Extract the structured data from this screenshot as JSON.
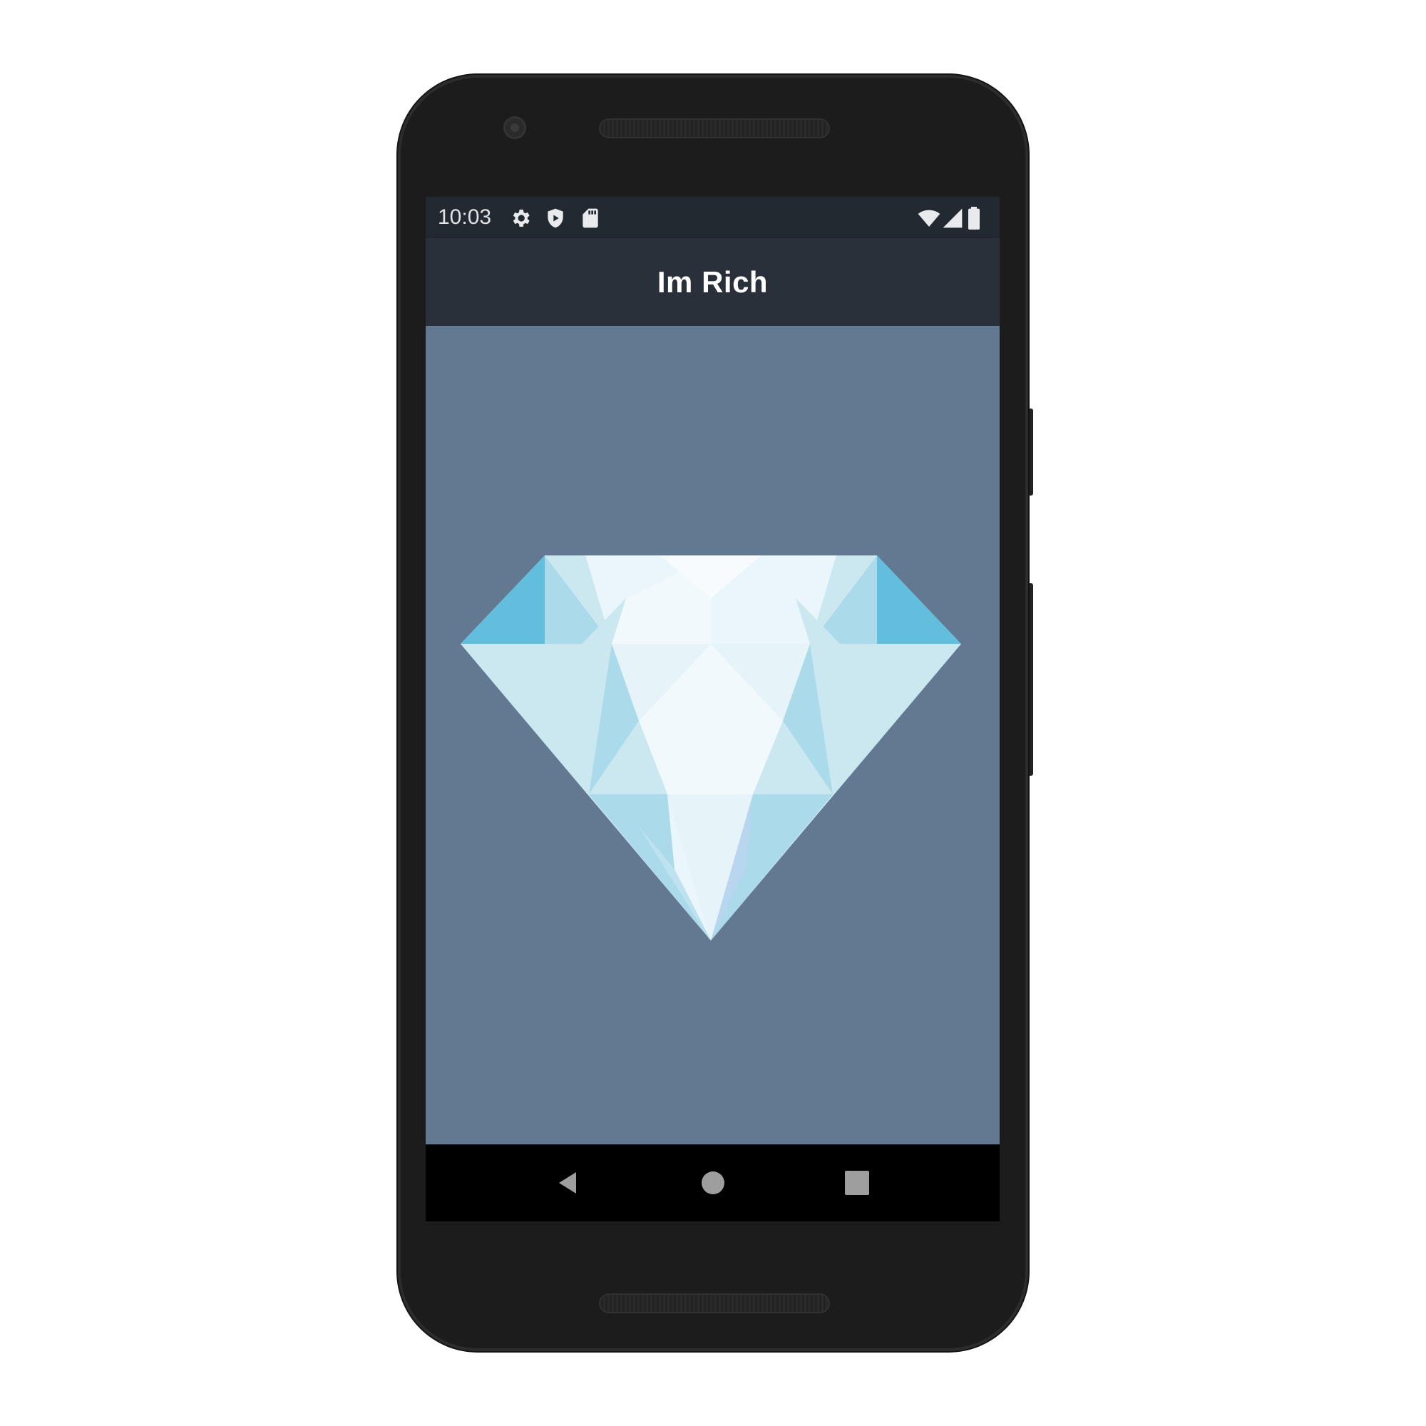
{
  "status_bar": {
    "time": "10:03",
    "left_icons": [
      "gear-icon",
      "shield-play-icon",
      "sd-card-icon"
    ],
    "right_icons": [
      "wifi-icon",
      "cell-signal-icon",
      "battery-icon"
    ]
  },
  "app_bar": {
    "title": "Im Rich"
  },
  "content": {
    "image": "diamond-image",
    "background_color": "#627991"
  },
  "nav_bar": {
    "buttons": [
      "back-button",
      "home-button",
      "recents-button"
    ]
  },
  "colors": {
    "status_bar": "#232931",
    "app_bar": "#2a3039",
    "content_background": "#627991",
    "nav_bar": "#000000",
    "diamond_light": "#eaf6fb",
    "diamond_mid": "#abdaea",
    "diamond_dark": "#62bedc"
  }
}
